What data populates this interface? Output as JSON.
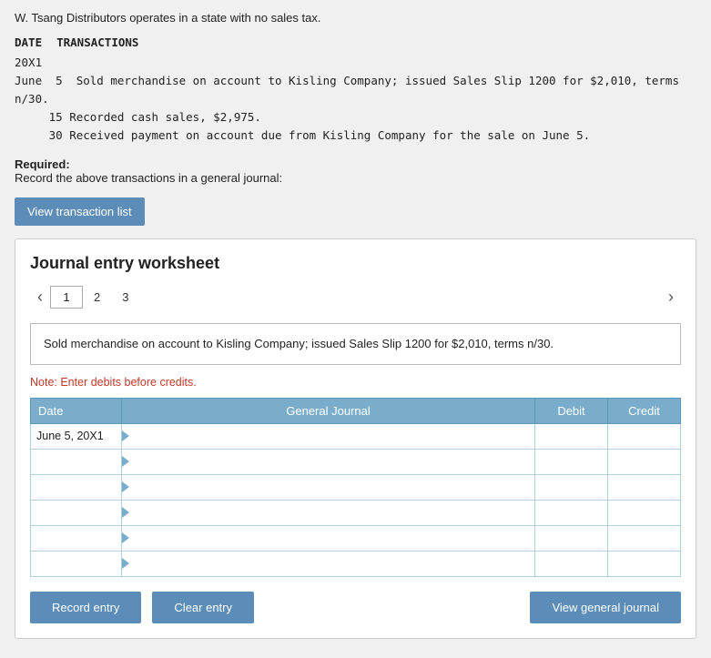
{
  "intro": {
    "text": "W. Tsang Distributors operates in a state with no sales tax."
  },
  "transactions": {
    "header_date": "DATE",
    "header_trans": "TRANSACTIONS",
    "year": "20X1",
    "entries": [
      {
        "month": "June",
        "day": "5",
        "text": "Sold merchandise on account to Kisling Company; issued Sales Slip 1200 for $2,010, terms n/30."
      },
      {
        "month": "",
        "day": "15",
        "text": "Recorded cash sales, $2,975."
      },
      {
        "month": "",
        "day": "30",
        "text": "Received payment on account due from Kisling Company for the sale on June 5."
      }
    ]
  },
  "required": {
    "label": "Required:",
    "text": "Record the above transactions in a general journal:"
  },
  "view_transactions_btn": "View transaction list",
  "worksheet": {
    "title": "Journal entry worksheet",
    "tabs": [
      {
        "label": "1",
        "active": true
      },
      {
        "label": "2",
        "active": false
      },
      {
        "label": "3",
        "active": false
      }
    ],
    "description": "Sold merchandise on account to Kisling Company; issued Sales Slip 1200 for $2,010, terms n/30.",
    "note": "Note: Enter debits before credits.",
    "table": {
      "headers": [
        "Date",
        "General Journal",
        "Debit",
        "Credit"
      ],
      "rows": [
        {
          "date": "June 5, 20X1",
          "gj": "",
          "debit": "",
          "credit": ""
        },
        {
          "date": "",
          "gj": "",
          "debit": "",
          "credit": ""
        },
        {
          "date": "",
          "gj": "",
          "debit": "",
          "credit": ""
        },
        {
          "date": "",
          "gj": "",
          "debit": "",
          "credit": ""
        },
        {
          "date": "",
          "gj": "",
          "debit": "",
          "credit": ""
        },
        {
          "date": "",
          "gj": "",
          "debit": "",
          "credit": ""
        }
      ]
    },
    "buttons": {
      "record": "Record entry",
      "clear": "Clear entry",
      "view_journal": "View general journal"
    }
  }
}
